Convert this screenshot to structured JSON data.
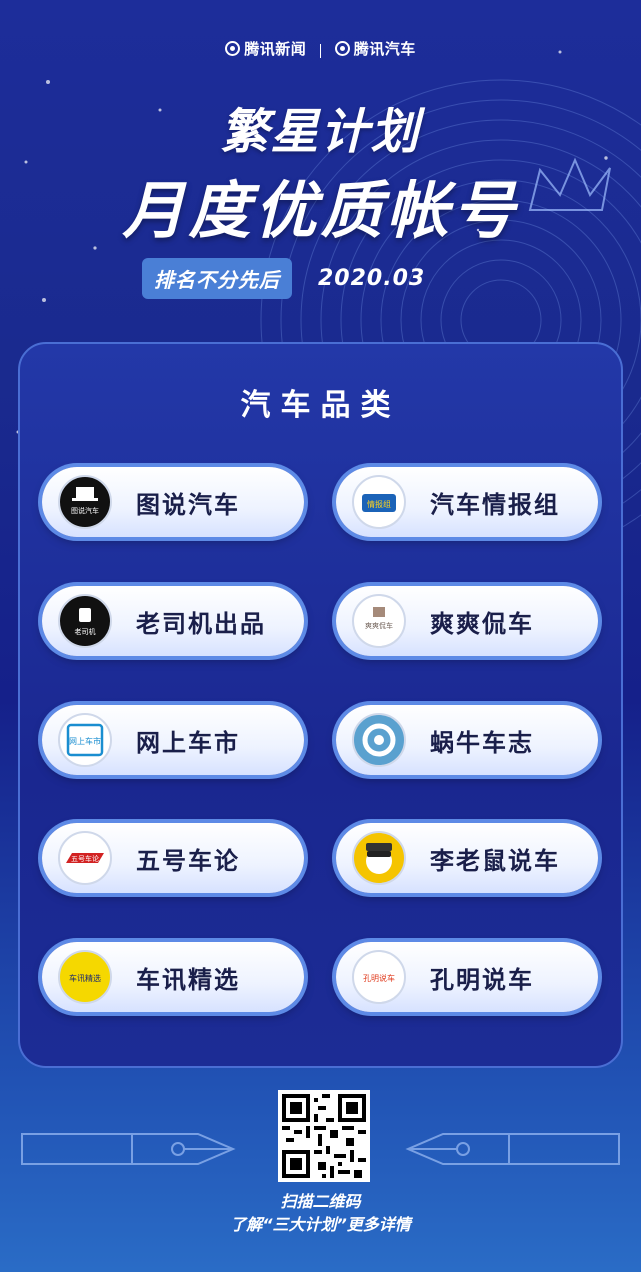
{
  "header": {
    "brand_left": "腾讯新闻",
    "brand_right": "腾讯汽车",
    "title_line1": "繁星计划",
    "title_line2": "月度优质帐号",
    "rank_note": "排名不分先后",
    "date": "2020.03"
  },
  "panel": {
    "category_title": "汽车品类",
    "accounts": [
      {
        "name": "图说汽车",
        "avatar_text": "图说汽车",
        "avatar_bg": "#111111",
        "avatar_fg": "#ffffff",
        "icon": "hat-avatar-icon"
      },
      {
        "name": "汽车情报组",
        "avatar_text": "情报组",
        "avatar_bg": "#1b63b8",
        "avatar_fg": "#ffd21e",
        "icon": "report-avatar-icon"
      },
      {
        "name": "老司机出品",
        "avatar_text": "老司机",
        "avatar_bg": "#111111",
        "avatar_fg": "#ffffff",
        "icon": "driver-avatar-icon"
      },
      {
        "name": "爽爽侃车",
        "avatar_text": "爽爽侃车",
        "avatar_bg": "#ffffff",
        "avatar_fg": "#6b5b53",
        "icon": "talk-avatar-icon"
      },
      {
        "name": "网上车市",
        "avatar_text": "网上车市",
        "avatar_bg": "#ffffff",
        "avatar_fg": "#1a8ed0",
        "icon": "market-avatar-icon"
      },
      {
        "name": "蜗牛车志",
        "avatar_text": "",
        "avatar_bg": "#5aa1cf",
        "avatar_fg": "#ffffff",
        "icon": "snail-avatar-icon"
      },
      {
        "name": "五号车论",
        "avatar_text": "五号车论",
        "avatar_bg": "#ffffff",
        "avatar_fg": "#d22222",
        "icon": "five-avatar-icon"
      },
      {
        "name": "李老鼠说车",
        "avatar_text": "",
        "avatar_bg": "#f5c400",
        "avatar_fg": "#222222",
        "icon": "mouse-avatar-icon"
      },
      {
        "name": "车讯精选",
        "avatar_text": "车讯精选",
        "avatar_bg": "#f5d800",
        "avatar_fg": "#1b2a70",
        "icon": "news-avatar-icon"
      },
      {
        "name": "孔明说车",
        "avatar_text": "孔明说车",
        "avatar_bg": "#ffffff",
        "avatar_fg": "#e03a1c",
        "icon": "kongming-avatar-icon"
      }
    ]
  },
  "footer": {
    "scan_text": "扫描二维码",
    "detail_text": "了解“三大计划”更多详情"
  },
  "colors": {
    "accent_blue": "#4a7fd6",
    "button_border": "#5d8ae6",
    "label_dark": "#1a1f4a"
  }
}
